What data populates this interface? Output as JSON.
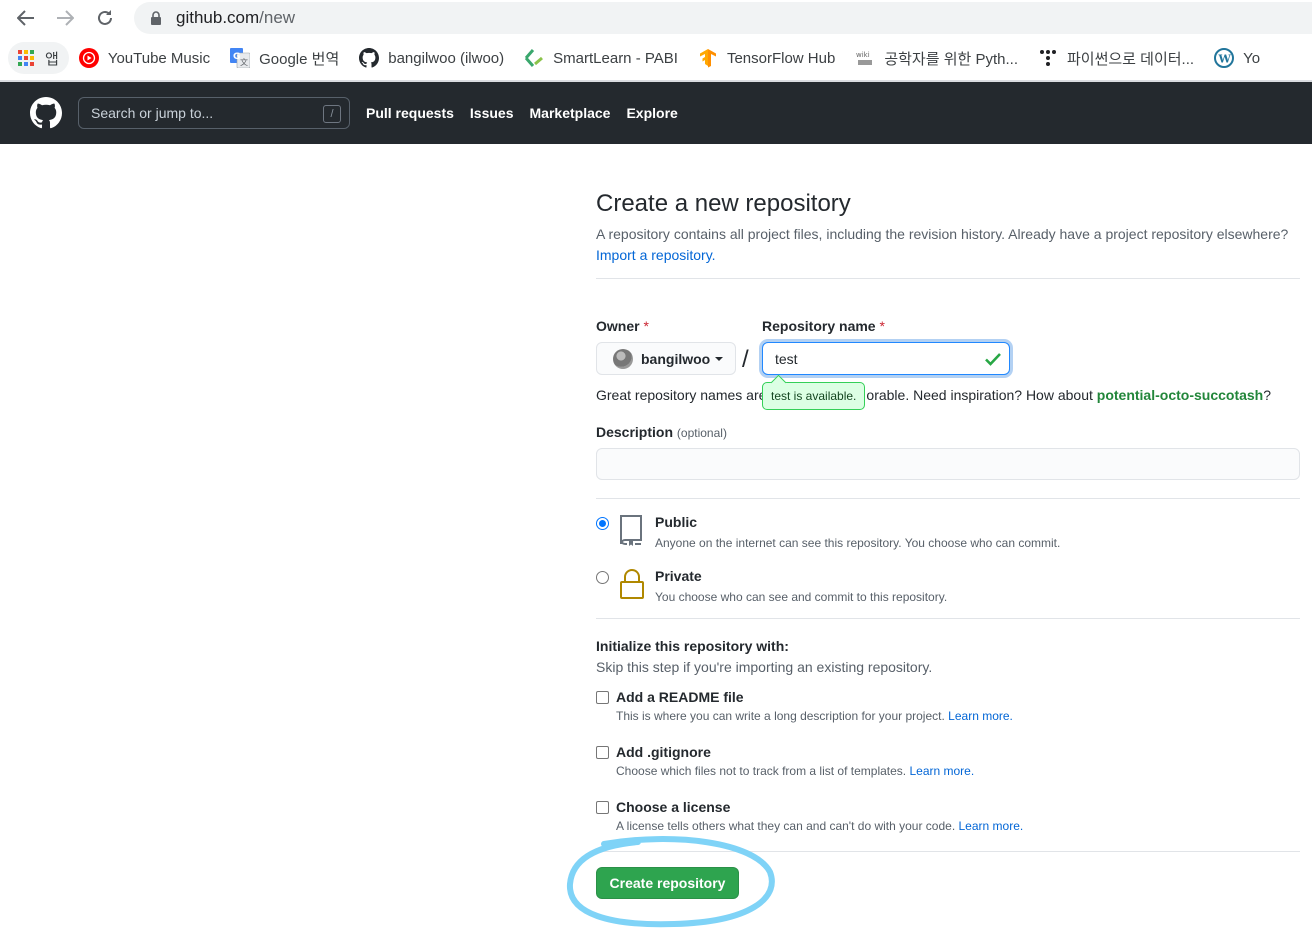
{
  "browser": {
    "url_host": "github.com",
    "url_path": "/new",
    "bookmarks": [
      {
        "label": "앱",
        "icon": "apps-grid-icon"
      },
      {
        "label": "YouTube Music",
        "icon": "youtube-music-icon"
      },
      {
        "label": "Google 번역",
        "icon": "google-translate-icon"
      },
      {
        "label": "bangilwoo (ilwoo)",
        "icon": "github-icon"
      },
      {
        "label": "SmartLearn - PABI",
        "icon": "smartlearn-icon"
      },
      {
        "label": "TensorFlow Hub",
        "icon": "tensorflow-icon"
      },
      {
        "label": "공학자를 위한 Pyth...",
        "icon": "wiki-icon"
      },
      {
        "label": "파이썬으로 데이터...",
        "icon": "dots-icon"
      },
      {
        "label": "Yo",
        "icon": "wordpress-icon"
      }
    ]
  },
  "header": {
    "search_placeholder": "Search or jump to...",
    "search_shortcut": "/",
    "nav": [
      "Pull requests",
      "Issues",
      "Marketplace",
      "Explore"
    ]
  },
  "page": {
    "title": "Create a new repository",
    "subhead": "A repository contains all project files, including the revision history. Already have a project repository elsewhere?",
    "import_link": "Import a repository."
  },
  "form": {
    "owner_label": "Owner",
    "required_mark": "*",
    "owner_value": "bangilwoo",
    "separator": "/",
    "repo_label": "Repository name",
    "repo_value": "test",
    "availability": "test is available.",
    "hint_start": "Great repository names are",
    "hint_end": "orable. Need inspiration? How about",
    "suggestion": "potential-octo-succotash",
    "hint_qmark": "?",
    "description_label": "Description",
    "description_optional": "(optional)",
    "description_value": ""
  },
  "visibility": {
    "selected": "public",
    "public_title": "Public",
    "public_note": "Anyone on the internet can see this repository. You choose who can commit.",
    "private_title": "Private",
    "private_note": "You choose who can see and commit to this repository."
  },
  "init": {
    "title": "Initialize this repository with:",
    "note": "Skip this step if you're importing an existing repository.",
    "learn_more": "Learn more.",
    "options": [
      {
        "title": "Add a README file",
        "note": "This is where you can write a long description for your project.",
        "checked": false
      },
      {
        "title": "Add .gitignore",
        "note": "Choose which files not to track from a list of templates.",
        "checked": false
      },
      {
        "title": "Choose a license",
        "note": "A license tells others what they can and can't do with your code.",
        "checked": false
      }
    ]
  },
  "submit": {
    "label": "Create repository",
    "color": "#2ea44f"
  },
  "annotation": {
    "ring_color": "#7fd3f7"
  }
}
